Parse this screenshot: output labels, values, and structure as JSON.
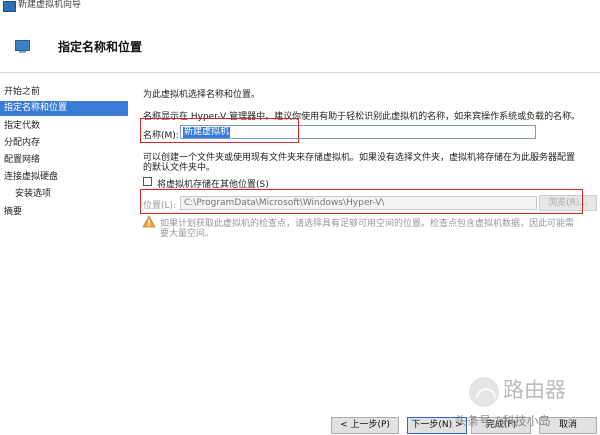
{
  "window": {
    "title": "新建虚拟机向导"
  },
  "header": {
    "title": "指定名称和位置"
  },
  "sidebar": {
    "items": [
      {
        "label": "开始之前"
      },
      {
        "label": "指定名称和位置"
      },
      {
        "label": "指定代数"
      },
      {
        "label": "分配内存"
      },
      {
        "label": "配置网络"
      },
      {
        "label": "连接虚拟硬盘"
      },
      {
        "label": "安装选项"
      },
      {
        "label": "摘要"
      }
    ]
  },
  "main": {
    "intro": "为此虚拟机选择名称和位置。",
    "name_hint": "名称显示在 Hyper-V 管理器中。建议你使用有助于轻松识别此虚拟机的名称，如来宾操作系统或负载的名称。",
    "name_label": "名称(M):",
    "name_value": "新建虚拟机",
    "folder_hint_line1": "可以创建一个文件夹或使用现有文件夹来存储虚拟机。如果没有选择文件夹，虚拟机将存储在为此服务器配置",
    "folder_hint_line2": "的默认文件夹中。",
    "store_checkbox_label": "将虚拟机存储在其他位置(S)",
    "location_label": "位置(L):",
    "location_value": "C:\\ProgramData\\Microsoft\\Windows\\Hyper-V\\",
    "browse_label": "浏览(R)...",
    "warning_line1": "如果计划获取此虚拟机的检查点，请选择具有足够可用空间的位置。检查点包含虚拟机数据，因此可能需",
    "warning_line2": "要大量空间。"
  },
  "footer": {
    "prev_label": "< 上一步(P)",
    "next_label": "下一步(N) >",
    "finish_label": "完成(F)",
    "cancel_label": "取消"
  },
  "watermark": {
    "brand": "路由器",
    "account": "头条号 / 科技小岛"
  },
  "colors": {
    "selection": "#3a7bd5",
    "annotation_red": "#d62828",
    "warning": "#e8a33d"
  }
}
